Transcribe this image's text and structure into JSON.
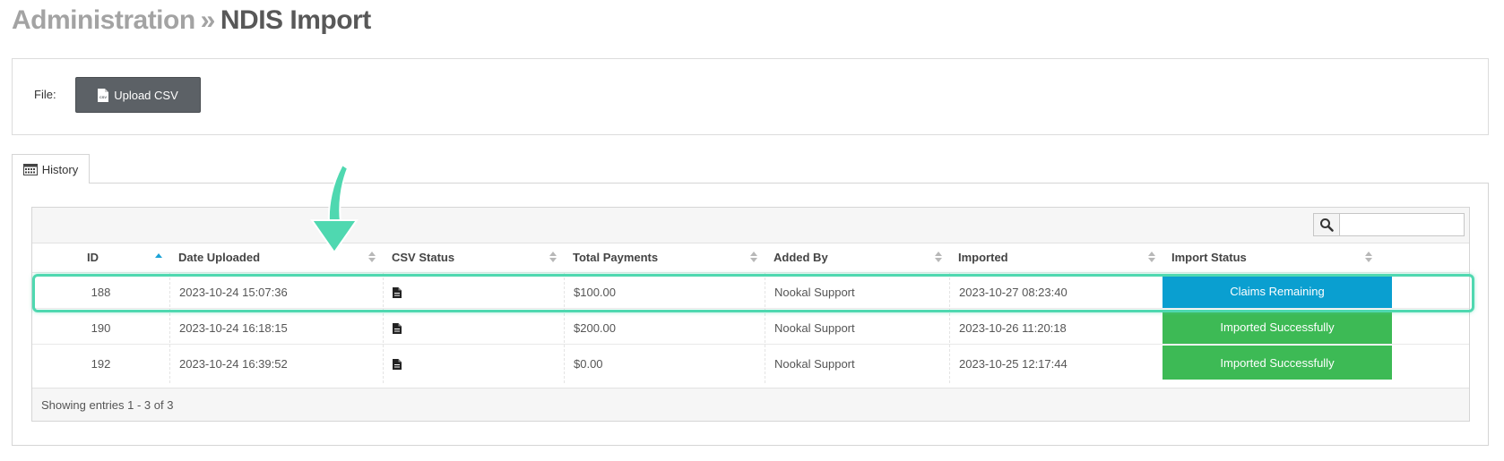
{
  "header": {
    "breadcrumb_parent": "Administration",
    "separator": "»",
    "current": "NDIS Import"
  },
  "file_panel": {
    "label": "File:",
    "upload_button": "Upload CSV",
    "icon": "csv-file-icon"
  },
  "tabs": [
    {
      "label": "History",
      "icon": "calendar-icon",
      "active": true
    }
  ],
  "grid": {
    "search": {
      "value": "",
      "placeholder": ""
    },
    "columns": [
      {
        "label": "ID",
        "sort": "asc"
      },
      {
        "label": "Date Uploaded",
        "sort": "none"
      },
      {
        "label": "CSV Status",
        "sort": "none"
      },
      {
        "label": "Total Payments",
        "sort": "none"
      },
      {
        "label": "Added By",
        "sort": "none"
      },
      {
        "label": "Imported",
        "sort": "none"
      },
      {
        "label": "Import Status",
        "sort": "none"
      }
    ],
    "rows": [
      {
        "id": "188",
        "date_uploaded": "2023-10-24 15:07:36",
        "csv_status_icon": "document-icon",
        "total_payments": "$100.00",
        "added_by": "Nookal Support",
        "imported": "2023-10-27 08:23:40",
        "import_status": "Claims Remaining",
        "status_color": "#0a9fd0",
        "highlighted": true
      },
      {
        "id": "190",
        "date_uploaded": "2023-10-24 16:18:15",
        "csv_status_icon": "document-icon",
        "total_payments": "$200.00",
        "added_by": "Nookal Support",
        "imported": "2023-10-26 11:20:18",
        "import_status": "Imported Successfully",
        "status_color": "#3dba55",
        "highlighted": false
      },
      {
        "id": "192",
        "date_uploaded": "2023-10-24 16:39:52",
        "csv_status_icon": "document-icon",
        "total_payments": "$0.00",
        "added_by": "Nookal Support",
        "imported": "2023-10-25 12:17:44",
        "import_status": "Imported Successfully",
        "status_color": "#3dba55",
        "highlighted": false
      }
    ],
    "footer": "Showing entries 1 - 3 of 3"
  },
  "colors": {
    "upload_button_bg": "#5c6166",
    "highlight": "#4fd8b0",
    "sort_active": "#1ca3d6"
  }
}
